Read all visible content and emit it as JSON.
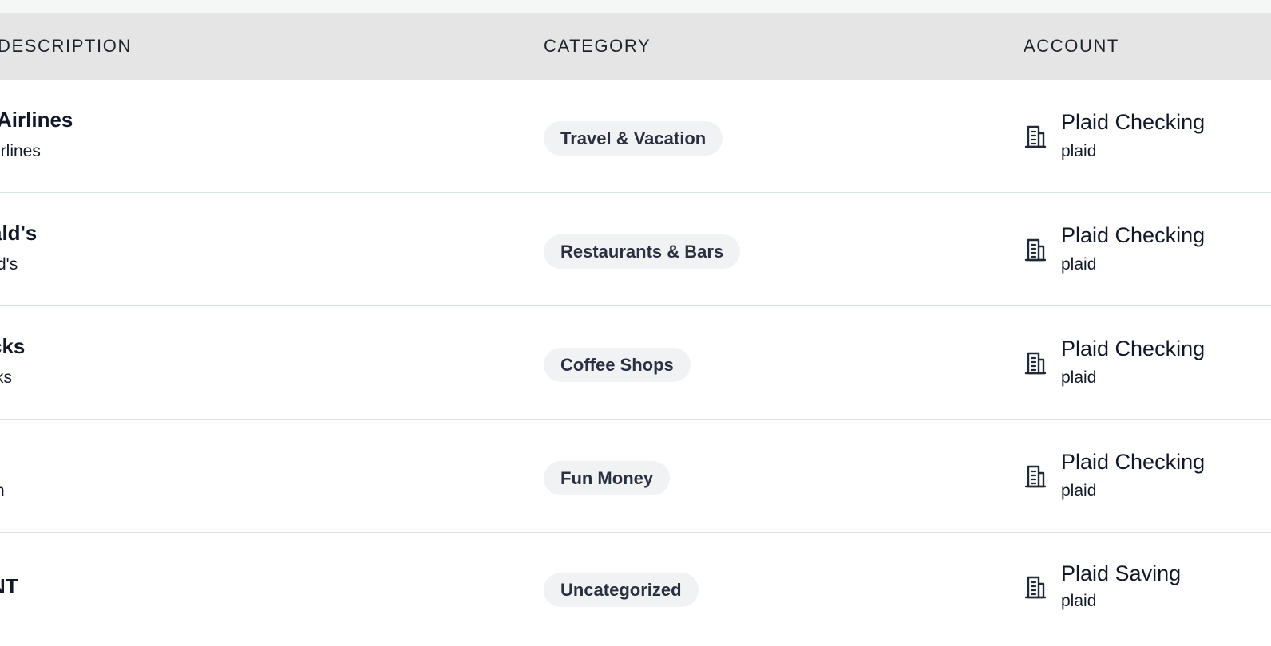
{
  "header": {
    "description": "DESCRIPTION",
    "category": "CATEGORY",
    "account": "ACCOUNT"
  },
  "rows": [
    {
      "description": "Airlines",
      "description_sub": "irlines",
      "category": "Travel & Vacation",
      "account": "Plaid Checking",
      "account_sub": "plaid"
    },
    {
      "description": "ald's",
      "description_sub": "d's",
      "category": "Restaurants & Bars",
      "account": "Plaid Checking",
      "account_sub": "plaid"
    },
    {
      "description": "cks",
      "description_sub": "ks",
      "category": "Coffee Shops",
      "account": "Plaid Checking",
      "account_sub": "plaid"
    },
    {
      "description": "",
      "description_sub": "n",
      "category": "Fun Money",
      "account": "Plaid Checking",
      "account_sub": "plaid"
    },
    {
      "description": "NT",
      "description_sub": "",
      "category": "Uncategorized",
      "account": "Plaid Saving",
      "account_sub": "plaid"
    }
  ],
  "icons": {
    "account": "building-icon"
  }
}
